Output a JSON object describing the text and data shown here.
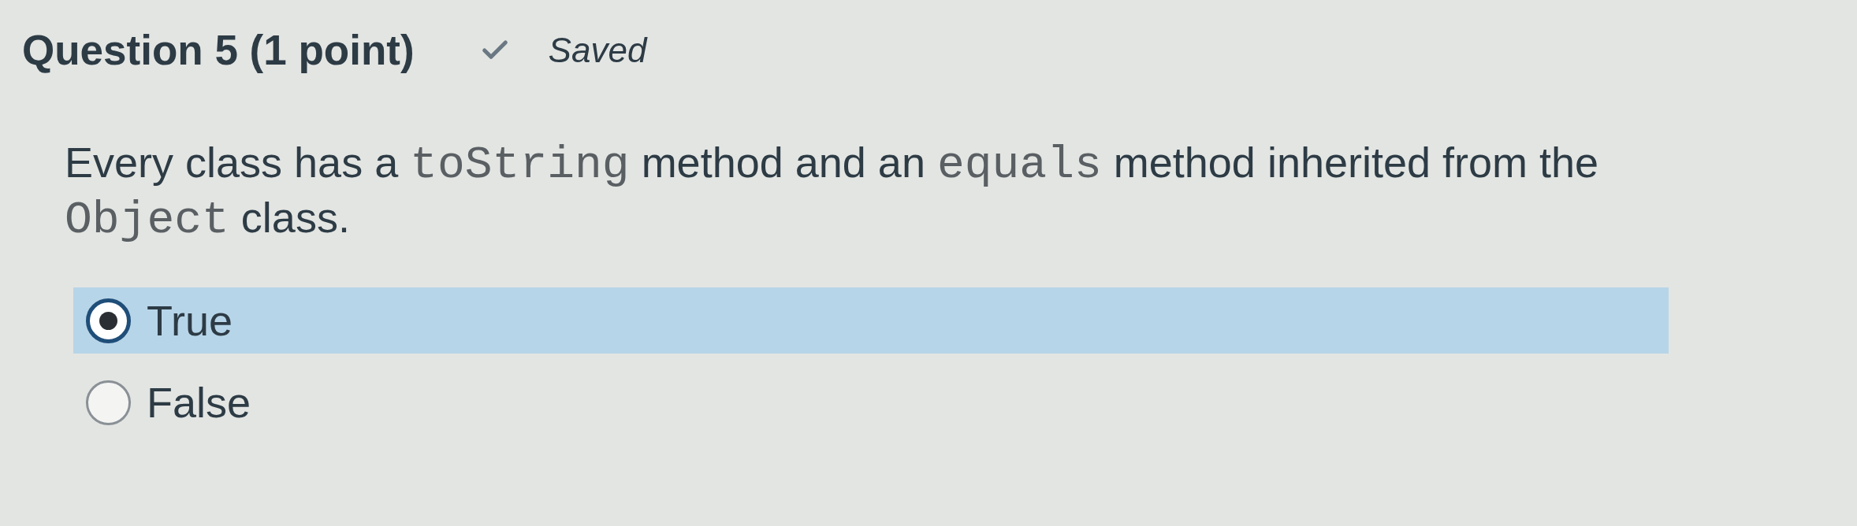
{
  "question": {
    "title": "Question 5 (1 point)",
    "status": {
      "text": "Saved",
      "saved": true
    }
  },
  "prompt": [
    {
      "kind": "text",
      "text": "Every class has a "
    },
    {
      "kind": "code",
      "text": "toString"
    },
    {
      "kind": "text",
      "text": " method and an "
    },
    {
      "kind": "code",
      "text": "equals"
    },
    {
      "kind": "text",
      "text": " method inherited from the "
    },
    {
      "kind": "code",
      "text": "Object"
    },
    {
      "kind": "text",
      "text": " class."
    }
  ],
  "options": [
    {
      "label": "True",
      "selected": true
    },
    {
      "label": "False",
      "selected": false
    }
  ]
}
